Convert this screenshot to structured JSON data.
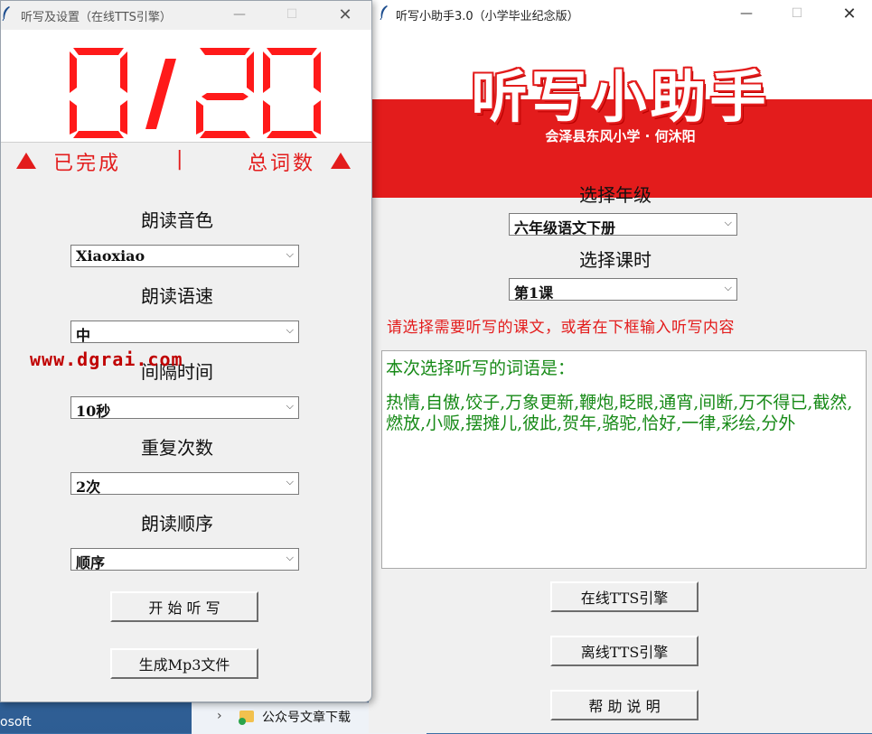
{
  "left_window": {
    "title": "听写及设置（在线TTS引擎）",
    "counter": {
      "done": "0",
      "sep": "/",
      "total": "20"
    },
    "done_label": "已完成",
    "total_label": "总词数",
    "divider": "|",
    "voice": {
      "label": "朗读音色",
      "value": "Xiaoxiao"
    },
    "speed": {
      "label": "朗读语速",
      "value": "中"
    },
    "interval": {
      "label": "间隔时间",
      "value": "10秒"
    },
    "repeat": {
      "label": "重复次数",
      "value": "2次"
    },
    "order": {
      "label": "朗读顺序",
      "value": "顺序"
    },
    "start_button": "开 始 听 写",
    "mp3_button": "生成Mp3文件",
    "watermark": "www.dgrai.com"
  },
  "right_window": {
    "title": "听写小助手3.0（小学毕业纪念版）",
    "banner_title": "听写小助手",
    "banner_subtitle": "会泽县东风小学 · 何沐阳",
    "grade": {
      "label": "选择年级",
      "value": "六年级语文下册"
    },
    "lesson": {
      "label": "选择课时",
      "value": "第1课"
    },
    "hint": "请选择需要听写的课文，或者在下框输入听写内容",
    "words_heading": "本次选择听写的词语是：",
    "words_body": "热情,自傲,饺子,万象更新,鞭炮,眨眼,通宵,间断,万不得已,截然,燃放,小贩,摆摊儿,彼此,贺年,骆驼,恰好,一律,彩绘,分外",
    "online_button": "在线TTS引擎",
    "offline_button": "离线TTS引擎",
    "help_button": "帮 助 说 明"
  },
  "taskbar": {
    "item_label": "公众号文章下载",
    "edge_text": "osoft"
  },
  "colors": {
    "accent_red": "#e31c1c",
    "text_green": "#178a17"
  },
  "icons": [
    "feather-icon",
    "minimize-icon",
    "maximize-icon",
    "close-icon",
    "chevron-down-icon",
    "triangle-up-icon",
    "folder-icon",
    "chevron-right-icon"
  ]
}
